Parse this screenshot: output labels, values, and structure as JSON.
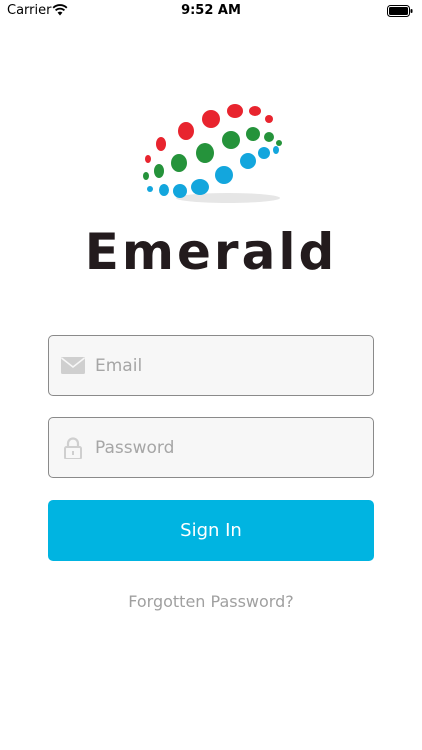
{
  "status_bar": {
    "carrier": "Carrier",
    "time": "9:52 AM",
    "wifi_icon": "wifi-icon",
    "battery_icon": "battery-icon"
  },
  "logo": {
    "brand_name": "Emerald",
    "colors": {
      "red": "#e8242e",
      "green": "#25933b",
      "blue": "#13a6dd",
      "text": "#231b1d"
    }
  },
  "form": {
    "email_placeholder": "Email",
    "email_value": "",
    "email_icon": "envelope-icon",
    "password_placeholder": "Password",
    "password_value": "",
    "password_icon": "lock-icon",
    "sign_in_label": "Sign In",
    "forgot_label": "Forgotten Password?"
  },
  "colors": {
    "accent": "#00b4e1",
    "field_bg": "#f7f7f7",
    "placeholder": "#a6a6a6"
  }
}
